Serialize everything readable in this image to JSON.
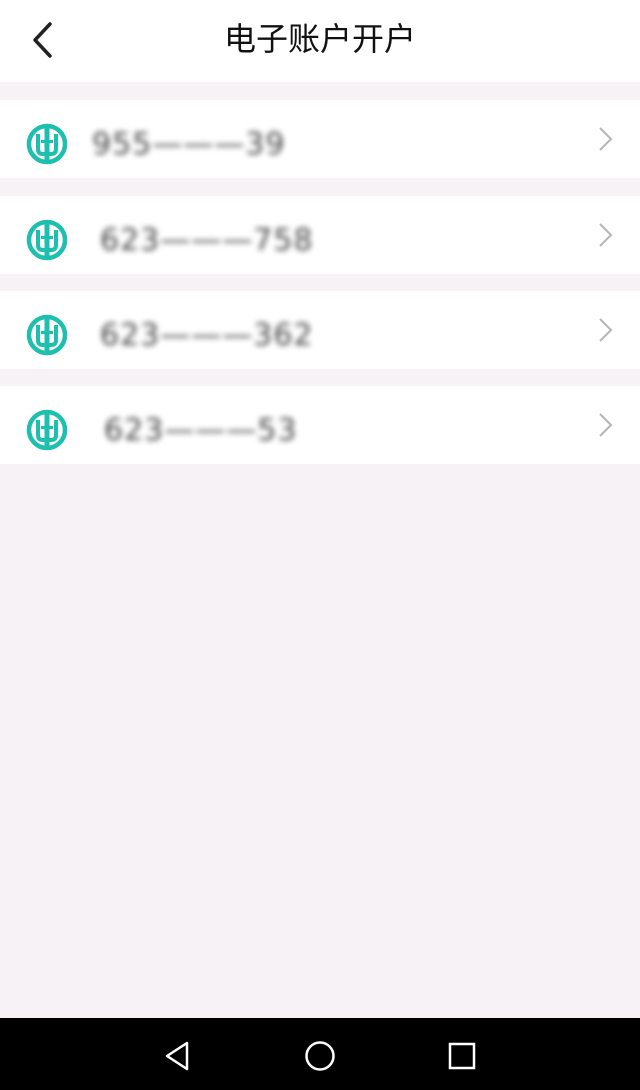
{
  "header": {
    "title": "电子账户开户",
    "back_icon": "chevron-left-icon"
  },
  "accounts": [
    {
      "number": "955———39",
      "icon": "abc-bank-logo-icon"
    },
    {
      "number": "623———758",
      "icon": "abc-bank-logo-icon"
    },
    {
      "number": "623———362",
      "icon": "abc-bank-logo-icon"
    },
    {
      "number": "623———53",
      "icon": "abc-bank-logo-icon"
    }
  ],
  "colors": {
    "brand": "#1dbfae",
    "background": "#f6f2f5",
    "card": "#ffffff",
    "chevron": "#b5b5b5",
    "navbar": "#000000"
  },
  "navbar": {
    "back_icon": "triangle-back-icon",
    "home_icon": "circle-home-icon",
    "recents_icon": "square-recents-icon"
  }
}
